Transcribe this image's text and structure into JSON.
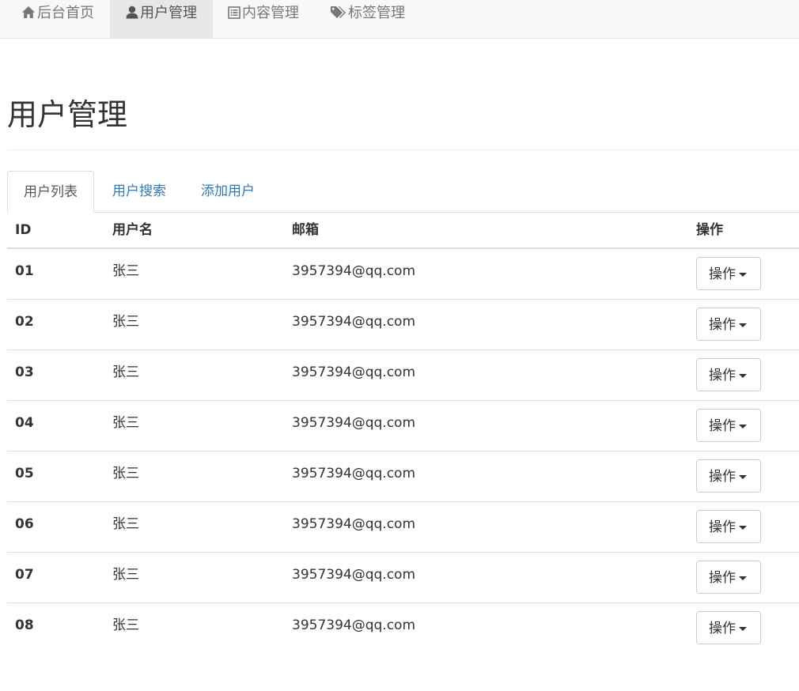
{
  "nav": {
    "items": [
      {
        "label": "后台首页",
        "icon": "home-icon"
      },
      {
        "label": "用户管理",
        "icon": "user-icon",
        "active": true
      },
      {
        "label": "内容管理",
        "icon": "list-icon"
      },
      {
        "label": "标签管理",
        "icon": "tags-icon"
      }
    ]
  },
  "page": {
    "title": "用户管理"
  },
  "tabs": [
    {
      "label": "用户列表",
      "active": true
    },
    {
      "label": "用户搜索"
    },
    {
      "label": "添加用户"
    }
  ],
  "table": {
    "headers": {
      "id": "ID",
      "name": "用户名",
      "email": "邮箱",
      "op": "操作"
    },
    "rows": [
      {
        "id": "01",
        "name": "张三",
        "email": "3957394@qq.com",
        "op": "操作"
      },
      {
        "id": "02",
        "name": "张三",
        "email": "3957394@qq.com",
        "op": "操作"
      },
      {
        "id": "03",
        "name": "张三",
        "email": "3957394@qq.com",
        "op": "操作"
      },
      {
        "id": "04",
        "name": "张三",
        "email": "3957394@qq.com",
        "op": "操作"
      },
      {
        "id": "05",
        "name": "张三",
        "email": "3957394@qq.com",
        "op": "操作"
      },
      {
        "id": "06",
        "name": "张三",
        "email": "3957394@qq.com",
        "op": "操作"
      },
      {
        "id": "07",
        "name": "张三",
        "email": "3957394@qq.com",
        "op": "操作"
      },
      {
        "id": "08",
        "name": "张三",
        "email": "3957394@qq.com",
        "op": "操作"
      }
    ]
  },
  "colors": {
    "link": "#337ab7",
    "navbar_bg": "#f8f8f8",
    "nav_active_bg": "#e7e7e7",
    "text": "#333333"
  }
}
